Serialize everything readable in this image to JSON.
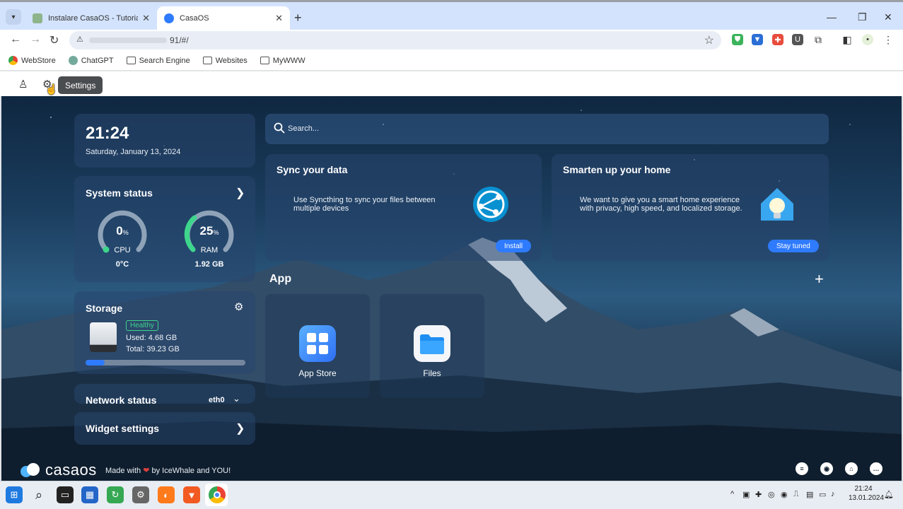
{
  "browser": {
    "tabs": [
      {
        "label": "Instalare CasaOS - Tutoriale IT ..."
      },
      {
        "label": "CasaOS"
      }
    ],
    "url": "91/#/",
    "bookmarks": [
      {
        "label": "WebStore"
      },
      {
        "label": "ChatGPT"
      },
      {
        "label": "Search Engine"
      },
      {
        "label": "Websites"
      },
      {
        "label": "MyWWW"
      }
    ]
  },
  "topbar": {
    "tooltip": "Settings"
  },
  "clock": {
    "time": "21:24",
    "date": "Saturday, January 13, 2024"
  },
  "system_status": {
    "title": "System status",
    "cpu": {
      "value": "0",
      "unit": "%",
      "label": "CPU",
      "sub": "0°C",
      "percent": 0
    },
    "ram": {
      "value": "25",
      "unit": "%",
      "label": "RAM",
      "sub": "1.92 GB",
      "percent": 25
    }
  },
  "storage": {
    "title": "Storage",
    "badge": "Healthy",
    "used": "Used: 4.68 GB",
    "total": "Total: 39.23 GB",
    "percent": 12
  },
  "network": {
    "title": "Network status",
    "interface": "eth0"
  },
  "widget_settings": {
    "title": "Widget settings"
  },
  "search": {
    "placeholder": "Search..."
  },
  "promos": [
    {
      "title": "Sync your data",
      "text": "Use Syncthing to sync your files between multiple devices",
      "button": "Install"
    },
    {
      "title": "Smarten up your home",
      "text": "We want to give you a smart home experience with privacy, high speed, and localized storage.",
      "button": "Stay tuned"
    }
  ],
  "apps": {
    "heading": "App",
    "items": [
      {
        "name": "App Store"
      },
      {
        "name": "Files"
      }
    ]
  },
  "footer": {
    "logo": "casaos",
    "made_with": "Made with",
    "by": "by IceWhale and YOU!"
  },
  "taskbar": {
    "time": "21:24",
    "date": "13.01.2024"
  },
  "colors": {
    "accent": "#2f7bff",
    "healthy": "#3dd68c",
    "gauge_cpu": "#3dd68c",
    "gauge_ram": "#3dd68c"
  }
}
